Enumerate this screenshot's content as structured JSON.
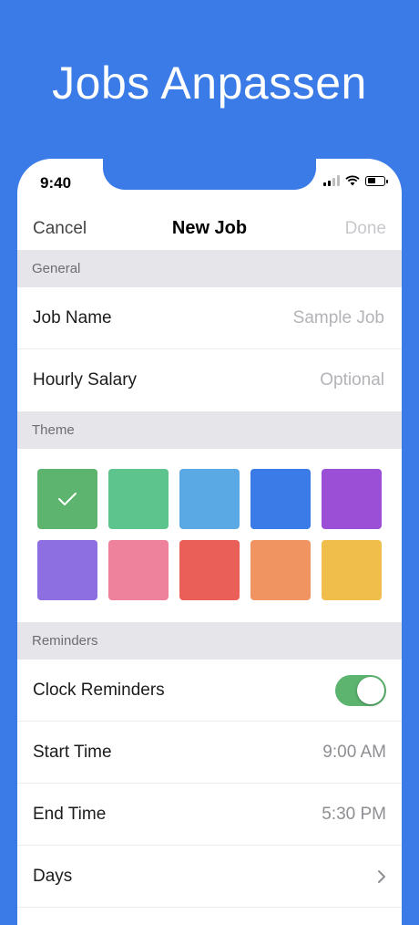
{
  "headline": "Jobs Anpassen",
  "status_bar": {
    "time": "9:40"
  },
  "navbar": {
    "cancel": "Cancel",
    "title": "New Job",
    "done": "Done"
  },
  "general": {
    "header": "General",
    "job_name": {
      "label": "Job Name",
      "placeholder": "Sample Job"
    },
    "hourly_salary": {
      "label": "Hourly Salary",
      "placeholder": "Optional"
    }
  },
  "theme": {
    "header": "Theme",
    "selected_index": 0,
    "colors": [
      "#5cb46f",
      "#5ec48e",
      "#5ba9e4",
      "#3a7be8",
      "#9b4fd6",
      "#8e6fe2",
      "#ee829c",
      "#ea5f57",
      "#f09562",
      "#efbe4b"
    ]
  },
  "reminders": {
    "header": "Reminders",
    "clock_reminders": {
      "label": "Clock Reminders",
      "on": true,
      "on_color": "#5cb46f"
    },
    "start_time": {
      "label": "Start Time",
      "value": "9:00 AM"
    },
    "end_time": {
      "label": "End Time",
      "value": "5:30 PM"
    },
    "days": {
      "label": "Days"
    }
  }
}
